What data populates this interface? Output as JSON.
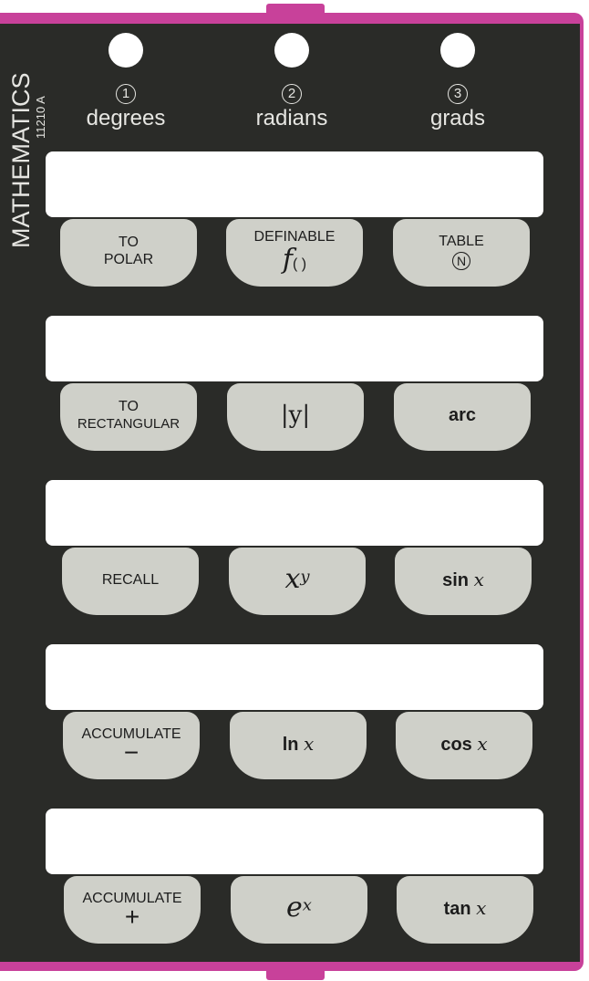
{
  "card": {
    "title": "MATHEMATICS",
    "model": "11210 A",
    "colors": {
      "body": "#2a2b28",
      "edge": "#c8419a",
      "key": "#cfd0c9"
    }
  },
  "modes": [
    {
      "number": "1",
      "label": "degrees"
    },
    {
      "number": "2",
      "label": "radians"
    },
    {
      "number": "3",
      "label": "grads"
    }
  ],
  "keys": {
    "to_polar": {
      "line1": "TO",
      "line2": "POLAR"
    },
    "definable": {
      "line1": "DEFINABLE",
      "symbol": "f",
      "parens": "( )"
    },
    "table": {
      "line1": "TABLE",
      "badge": "N"
    },
    "to_rect": {
      "line1": "TO",
      "line2": "RECTANGULAR"
    },
    "abs_y": {
      "label": "|y|"
    },
    "arc": {
      "label": "arc"
    },
    "recall": {
      "label": "RECALL"
    },
    "x_pow_y": {
      "base": "x",
      "exp": "y"
    },
    "sin": {
      "fn": "sin",
      "var": "x"
    },
    "acc_minus": {
      "line1": "ACCUMULATE",
      "symbol": "−"
    },
    "ln": {
      "fn": "ln",
      "var": "x"
    },
    "cos": {
      "fn": "cos",
      "var": "x"
    },
    "acc_plus": {
      "line1": "ACCUMULATE",
      "symbol": "+"
    },
    "e_pow_x": {
      "base": "e",
      "exp": "x"
    },
    "tan": {
      "fn": "tan",
      "var": "x"
    }
  }
}
